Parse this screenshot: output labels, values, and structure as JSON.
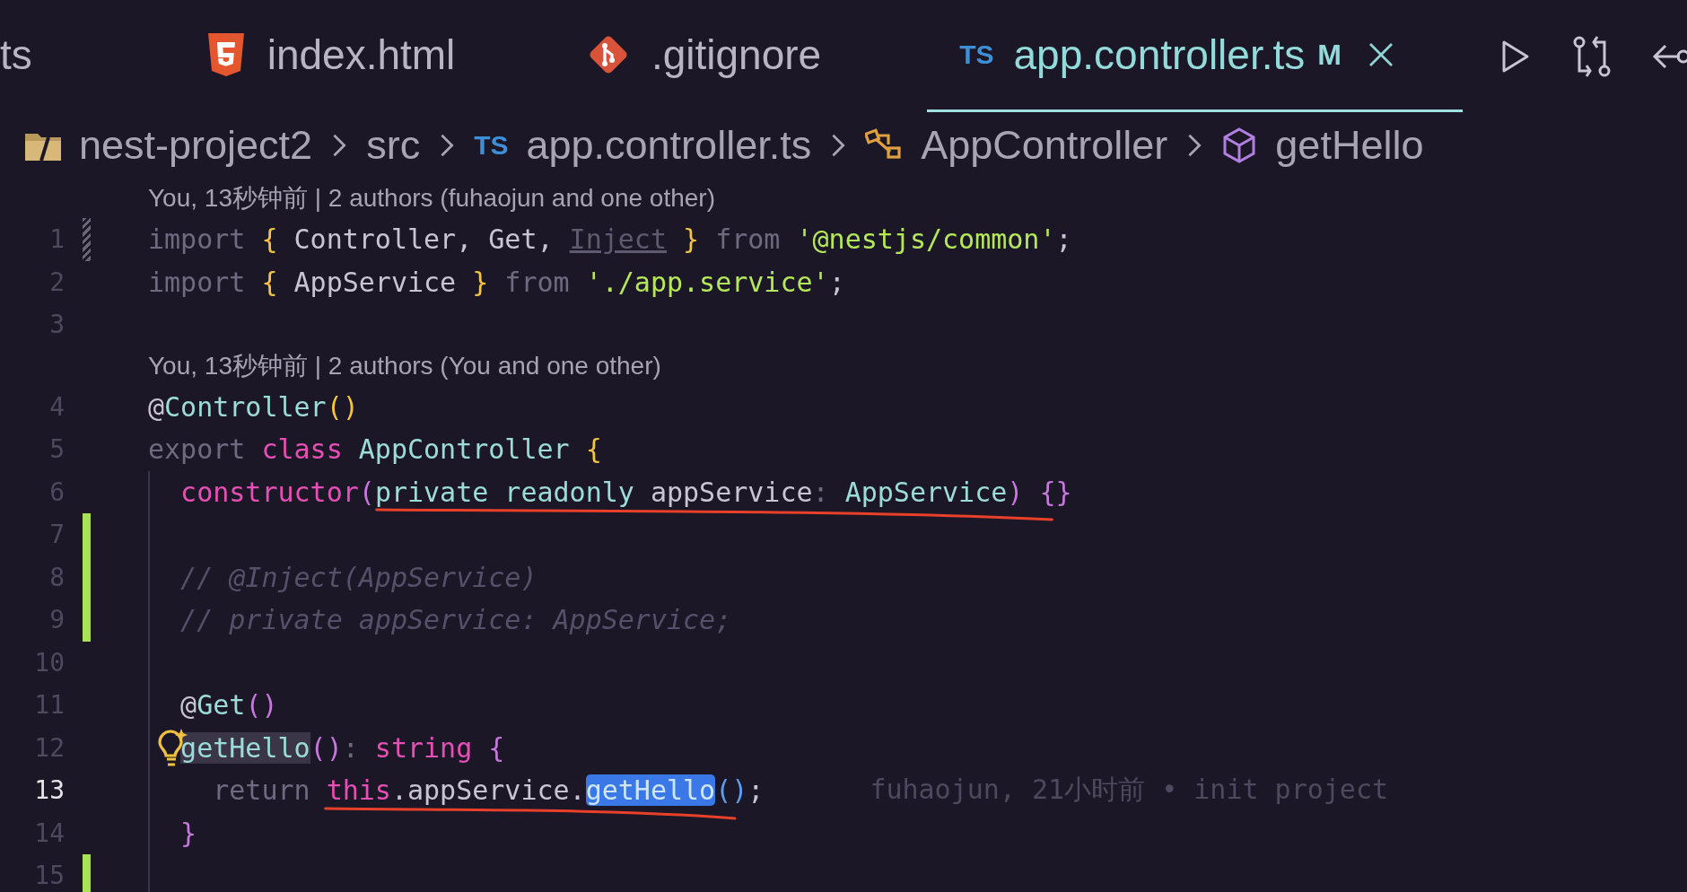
{
  "tabs": [
    {
      "label": "ts",
      "selected": false
    },
    {
      "label": "index.html",
      "kind": "html",
      "selected": false
    },
    {
      "label": ".gitignore",
      "kind": "git",
      "selected": false
    },
    {
      "label": "app.controller.ts",
      "kind": "ts",
      "icon_text": "TS",
      "badge": "M",
      "closable": true,
      "selected": true
    }
  ],
  "breadcrumbs": [
    {
      "label": "nest-project2",
      "kind": "folder"
    },
    {
      "label": "src"
    },
    {
      "label": "app.controller.ts",
      "kind": "ts",
      "icon_text": "TS"
    },
    {
      "label": "AppController",
      "kind": "class"
    },
    {
      "label": "getHello",
      "kind": "method"
    }
  ],
  "lines": [
    {
      "kind": "codelens",
      "text": "You, 13秒钟前 | 2 authors (fuhaojun and one other)"
    },
    {
      "kind": "code",
      "number": "1",
      "modified": true,
      "tokens": [
        {
          "text": "import ",
          "kind": "kw"
        },
        {
          "text": "{",
          "kind": "brace"
        },
        {
          "text": " Controller, Get, ",
          "kind": "plain"
        },
        {
          "text": "Inject",
          "kind": "unused"
        },
        {
          "text": " }",
          "kind": "brace"
        },
        {
          "text": " from ",
          "kind": "kw"
        },
        {
          "text": "'@nestjs/common'",
          "kind": "string"
        },
        {
          "text": ";",
          "kind": "plain"
        }
      ]
    },
    {
      "kind": "code",
      "number": "2",
      "tokens": [
        {
          "text": "import ",
          "kind": "kw"
        },
        {
          "text": "{",
          "kind": "brace"
        },
        {
          "text": " AppService ",
          "kind": "plain"
        },
        {
          "text": "}",
          "kind": "brace"
        },
        {
          "text": " from ",
          "kind": "kw"
        },
        {
          "text": "'./app.service'",
          "kind": "string"
        },
        {
          "text": ";",
          "kind": "plain"
        }
      ]
    },
    {
      "kind": "code",
      "number": "3"
    },
    {
      "kind": "codelens",
      "text": "You, 13秒钟前 | 2 authors (You and one other)"
    },
    {
      "kind": "code",
      "number": "4",
      "tokens": [
        {
          "text": "@",
          "kind": "plain"
        },
        {
          "text": "Controller",
          "kind": "type"
        },
        {
          "text": "()",
          "kind": "brace"
        }
      ]
    },
    {
      "kind": "code",
      "number": "5",
      "tokens": [
        {
          "text": "export ",
          "kind": "kw"
        },
        {
          "text": "class ",
          "kind": "pink"
        },
        {
          "text": "AppController ",
          "kind": "type"
        },
        {
          "text": "{",
          "kind": "brace"
        }
      ]
    },
    {
      "kind": "code",
      "number": "6",
      "in_block": true,
      "tokens": [
        {
          "text": "  constructor",
          "kind": "pink"
        },
        {
          "text": "(",
          "kind": "punct"
        },
        {
          "kind": "group",
          "underlined": true,
          "tokens": [
            {
              "text": "private readonly",
              "kind": "type"
            },
            {
              "text": " appService",
              "kind": "plain"
            },
            {
              "text": ": ",
              "kind": "kw"
            },
            {
              "text": "AppService",
              "kind": "type"
            },
            {
              "text": ")",
              "kind": "punct"
            }
          ]
        },
        {
          "text": " {}",
          "kind": "punct"
        }
      ]
    },
    {
      "kind": "code",
      "number": "7",
      "added": true,
      "in_block": true
    },
    {
      "kind": "code",
      "number": "8",
      "added": true,
      "in_block": true,
      "tokens": [
        {
          "text": "  // @Inject(AppService)",
          "kind": "comment"
        }
      ]
    },
    {
      "kind": "code",
      "number": "9",
      "added": true,
      "in_block": true,
      "tokens": [
        {
          "text": "  // private appService: AppService;",
          "kind": "comment"
        }
      ]
    },
    {
      "kind": "code",
      "number": "10",
      "in_block": true
    },
    {
      "kind": "code",
      "number": "11",
      "in_block": true,
      "tokens": [
        {
          "text": "  @",
          "kind": "plain"
        },
        {
          "text": "Get",
          "kind": "type"
        },
        {
          "text": "()",
          "kind": "punct"
        }
      ]
    },
    {
      "kind": "code",
      "number": "12",
      "in_block": true,
      "lightbulb": true,
      "indented": true,
      "tokens": [
        {
          "text": "getHello",
          "kind": "word"
        },
        {
          "text": "()",
          "kind": "punct"
        },
        {
          "text": ": ",
          "kind": "kw"
        },
        {
          "text": "string ",
          "kind": "pink"
        },
        {
          "text": "{",
          "kind": "punct"
        }
      ]
    },
    {
      "kind": "code",
      "number": "13",
      "current": true,
      "in_block": true,
      "blame": "fuhaojun, 21小时前 • init project",
      "tokens": [
        {
          "text": "    return ",
          "kind": "kw"
        },
        {
          "kind": "group",
          "underlined": true,
          "tokens": [
            {
              "text": "this",
              "kind": "pink"
            },
            {
              "text": ".appService.",
              "kind": "plain"
            },
            {
              "text": "getHello",
              "kind": "selection"
            }
          ]
        },
        {
          "text": "()",
          "kind": "blue"
        },
        {
          "text": ";",
          "kind": "plain"
        }
      ]
    },
    {
      "kind": "code",
      "number": "14",
      "in_block": true,
      "tokens": [
        {
          "text": "  }",
          "kind": "punct"
        }
      ]
    },
    {
      "kind": "code",
      "number": "15",
      "added": true,
      "in_block": true
    }
  ]
}
